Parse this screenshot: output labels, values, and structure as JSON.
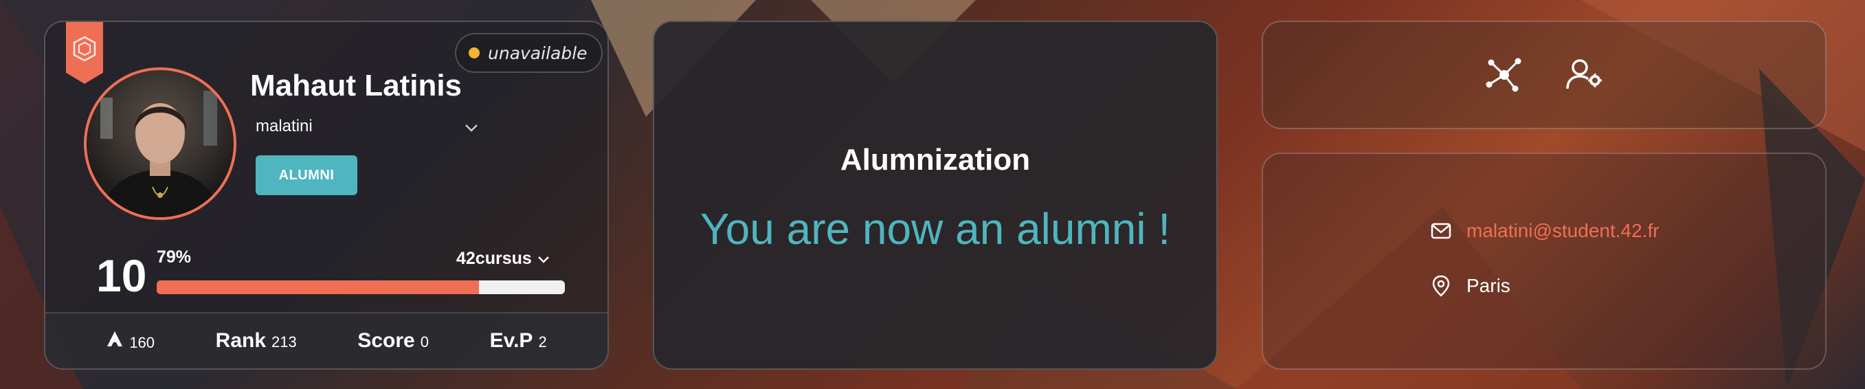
{
  "colors": {
    "accent": "#ef6f55",
    "teal": "#4fb5bf",
    "status_dot": "#f5b52f"
  },
  "profile": {
    "ribbon_icon": "hexagon-icon",
    "status": "unavailable",
    "display_name": "Mahaut Latinis",
    "login": "malatini",
    "badge": "ALUMNI",
    "level": "10",
    "level_percent": "79%",
    "level_progress": 0.79,
    "cursus": "42cursus",
    "stats": {
      "wallet_value": "160",
      "rank_label": "Rank",
      "rank_value": "213",
      "score_label": "Score",
      "score_value": "0",
      "evp_label": "Ev.P",
      "evp_value": "2"
    }
  },
  "alumnization": {
    "title": "Alumnization",
    "message": "You are now an alumni !"
  },
  "actions": {
    "icons": [
      "network-graph-icon",
      "user-settings-icon"
    ]
  },
  "contact": {
    "email": "malatini@student.42.fr",
    "location": "Paris"
  }
}
